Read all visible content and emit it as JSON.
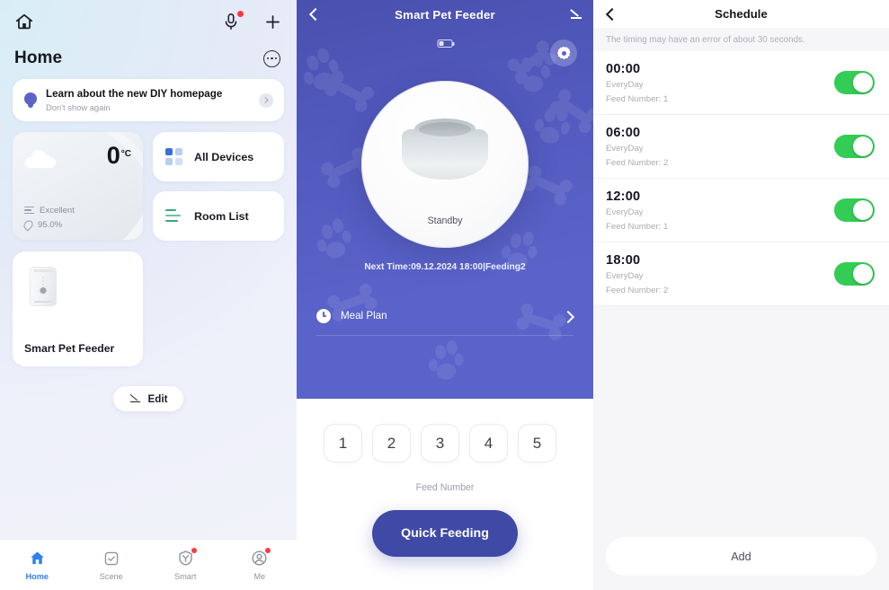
{
  "home": {
    "title": "Home",
    "icons": {
      "home": "home-icon",
      "mic": "microphone-icon",
      "add": "plus-icon",
      "more": "more-dots-icon"
    },
    "banner": {
      "title": "Learn about the new DIY homepage",
      "subtitle": "Don't show again",
      "icon": "lightbulb-icon"
    },
    "weather": {
      "temperature": "0",
      "unit": "°C",
      "air_quality": "Excellent",
      "humidity": "95.0%",
      "icon": "cloud-icon"
    },
    "shortcuts": [
      {
        "label": "All Devices",
        "icon": "grid-icon"
      },
      {
        "label": "Room List",
        "icon": "list-icon"
      }
    ],
    "devices": [
      {
        "name": "Smart Pet Feeder",
        "icon": "pet-feeder-icon"
      }
    ],
    "edit_label": "Edit",
    "tabs": [
      {
        "label": "Home",
        "icon": "home-icon",
        "active": true,
        "badge": false
      },
      {
        "label": "Scene",
        "icon": "scene-check-icon",
        "active": false,
        "badge": false
      },
      {
        "label": "Smart",
        "icon": "smart-shield-icon",
        "active": false,
        "badge": true
      },
      {
        "label": "Me",
        "icon": "profile-icon",
        "active": false,
        "badge": true
      }
    ]
  },
  "device": {
    "title": "Smart Pet Feeder",
    "back_icon": "back-chevron-icon",
    "edit_icon": "pencil-icon",
    "battery_icon": "battery-icon",
    "settings_icon": "gear-icon",
    "status": "Standby",
    "next_time": "Next Time:09.12.2024 18:00|Feeding2",
    "meal_plan": {
      "label": "Meal Plan",
      "icon": "clock-icon",
      "chevron": "chevron-right-icon"
    },
    "feed_numbers": [
      "1",
      "2",
      "3",
      "4",
      "5"
    ],
    "feed_caption": "Feed Number",
    "quick_feed_label": "Quick Feeding",
    "accent_color": "#3f49a6"
  },
  "schedule": {
    "title": "Schedule",
    "back_icon": "back-chevron-icon",
    "note": "The timing may have an error of about 30 seconds.",
    "toggle_on_color": "#33cc55",
    "items": [
      {
        "time": "00:00",
        "repeat": "EveryDay",
        "feed": "Feed Number: 1",
        "enabled": true
      },
      {
        "time": "06:00",
        "repeat": "EveryDay",
        "feed": "Feed Number: 2",
        "enabled": true
      },
      {
        "time": "12:00",
        "repeat": "EveryDay",
        "feed": "Feed Number: 1",
        "enabled": true
      },
      {
        "time": "18:00",
        "repeat": "EveryDay",
        "feed": "Feed Number: 2",
        "enabled": true
      }
    ],
    "add_label": "Add"
  }
}
